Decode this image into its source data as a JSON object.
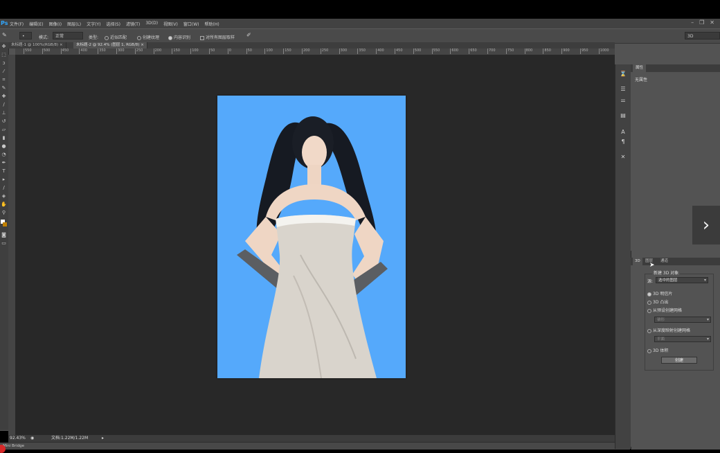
{
  "app": {
    "logo": "Ps",
    "window_controls": [
      "–",
      "❐",
      "✕"
    ]
  },
  "menu": [
    "文件(F)",
    "编辑(E)",
    "图像(I)",
    "图层(L)",
    "文字(Y)",
    "选择(S)",
    "滤镜(T)",
    "3D(D)",
    "视图(V)",
    "窗口(W)",
    "帮助(H)"
  ],
  "options": {
    "mode_label": "模式:",
    "mode_value": "正常",
    "type_label": "类型:",
    "type_options": [
      "近似匹配",
      "创建纹理",
      "内容识别"
    ],
    "sample_all_layers": "对所有图层取样",
    "workspace": "3D"
  },
  "tabs": [
    "未标题-1 @ 100%(RGB/8)",
    "未标题-2 @ 92.4% (图层 1, RGB/8)"
  ],
  "ruler": [
    "550",
    "500",
    "450",
    "400",
    "350",
    "300",
    "250",
    "200",
    "150",
    "100",
    "50",
    "0",
    "50",
    "100",
    "150",
    "200",
    "250",
    "300",
    "350",
    "400",
    "450",
    "500",
    "550",
    "600",
    "650",
    "700",
    "750",
    "800",
    "850",
    "900",
    "950",
    "1000",
    "1050"
  ],
  "status": {
    "zoom": "92.43%",
    "doc": "文档:1.22M/1.22M"
  },
  "minibridge": "Mini Bridge",
  "properties": {
    "tab": "属性",
    "text": "无属性"
  },
  "panel3d": {
    "tabs": [
      "3D",
      "图层",
      "通道"
    ],
    "title": "新建 3D 对象",
    "source_label": "源:",
    "source_value": "选中的图层",
    "options": [
      "3D 明信片",
      "3D 凸出",
      "从预设创建网格",
      "从深度映射创建网格",
      "3D 体积"
    ],
    "preset_value": "锥形",
    "depth_value": "平面",
    "create_label": "创建"
  },
  "nav": {
    "next": "›"
  }
}
